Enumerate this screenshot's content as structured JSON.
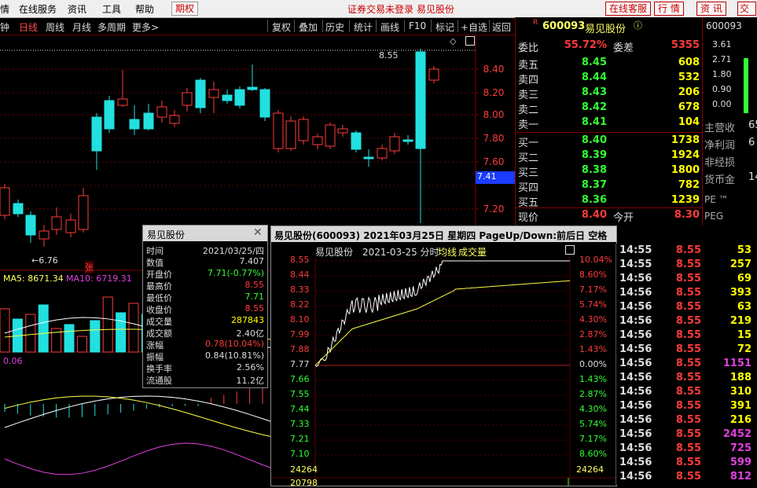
{
  "menubar": {
    "items": [
      "情",
      "在线服务",
      "资讯",
      "工具",
      "帮助"
    ],
    "active": "期权",
    "status": "证券交易未登录",
    "stock_name": "易见股份",
    "right_buttons": [
      "在线客服",
      "行 情",
      "资 讯",
      "交"
    ]
  },
  "toolbar": {
    "periods": [
      "钟",
      "日线",
      "周线",
      "月线",
      "多周期",
      "更多>"
    ],
    "tools": [
      "复权",
      "叠加",
      "历史",
      "统计",
      "画线",
      "F10",
      "标记",
      "+自选",
      "返回"
    ]
  },
  "kchart": {
    "price_labels": [
      "8.40",
      "8.20",
      "8.00",
      "7.80",
      "7.60",
      "7.20"
    ],
    "current_price": "7.41",
    "high_marker": "8.55",
    "low_marker": "6.76",
    "zhang": "张",
    "ma5": "MA5: 8671.34",
    "ma10": "MA10: 6719.31",
    "macd_val": "0.06"
  },
  "book": {
    "code": "600093",
    "name": "易见股份",
    "r_mark": "R",
    "wei_bi_label": "委比",
    "wei_bi": "55.72%",
    "wei_cha_label": "委差",
    "wei_cha": "5355",
    "sell": [
      {
        "label": "卖五",
        "price": "8.45",
        "vol": "608"
      },
      {
        "label": "卖四",
        "price": "8.44",
        "vol": "532"
      },
      {
        "label": "卖三",
        "price": "8.43",
        "vol": "206"
      },
      {
        "label": "卖二",
        "price": "8.42",
        "vol": "678"
      },
      {
        "label": "卖一",
        "price": "8.41",
        "vol": "104"
      }
    ],
    "buy": [
      {
        "label": "买一",
        "price": "8.40",
        "vol": "1738"
      },
      {
        "label": "买二",
        "price": "8.39",
        "vol": "1924"
      },
      {
        "label": "买三",
        "price": "8.38",
        "vol": "1800"
      },
      {
        "label": "买四",
        "price": "8.37",
        "vol": "782"
      },
      {
        "label": "买五",
        "price": "8.36",
        "vol": "1239"
      }
    ],
    "now_label": "现价",
    "now_price": "8.40",
    "open_label": "今开",
    "open_price": "8.30"
  },
  "mini": {
    "code": "600093",
    "values": [
      "3.61",
      "2.71",
      "1.80",
      "0.90",
      "0.00"
    ],
    "fund_labels": [
      "主营收",
      "净利润",
      "非经损",
      "货币金"
    ],
    "fund_vals": [
      "65",
      "6",
      "",
      "14"
    ],
    "pe": "PE ™",
    "peg": "PEG"
  },
  "info": {
    "title": "易见股份",
    "rows": [
      {
        "k": "时间",
        "v": "2021/03/25/四",
        "c": "#ddd"
      },
      {
        "k": "数值",
        "v": "7.407",
        "c": "#ddd"
      },
      {
        "k": "开盘价",
        "v": "7.71(-0.77%)",
        "c": "#3f3"
      },
      {
        "k": "最高价",
        "v": "8.55",
        "c": "#ff3b3b"
      },
      {
        "k": "最低价",
        "v": "7.71",
        "c": "#3f3"
      },
      {
        "k": "收盘价",
        "v": "8.55",
        "c": "#ff3b3b"
      },
      {
        "k": "成交量",
        "v": "287843",
        "c": "#ff0"
      },
      {
        "k": "成交额",
        "v": "2.40亿",
        "c": "#ddd"
      },
      {
        "k": "涨幅",
        "v": "0.78(10.04%)",
        "c": "#ff3b3b"
      },
      {
        "k": "振幅",
        "v": "0.84(10.81%)",
        "c": "#ddd"
      },
      {
        "k": "换手率",
        "v": "2.56%",
        "c": "#ddd"
      },
      {
        "k": "流通股",
        "v": "11.2亿",
        "c": "#ddd"
      }
    ]
  },
  "intra": {
    "title": "易见股份(600093) 2021年03月25日 星期四 PageUp/Down:前后日 空格键:操作",
    "sub_name": "易见股份",
    "sub_date": "2021-03-25 分时",
    "avg_label": "均线",
    "vol_label": "成交量",
    "left_prices": [
      "8.55",
      "8.44",
      "8.33",
      "8.22",
      "8.10",
      "7.99",
      "7.88",
      "7.77",
      "7.66",
      "7.55",
      "7.44",
      "7.33",
      "7.21",
      "7.10"
    ],
    "right_pcts": [
      "10.04%",
      "8.60%",
      "7.17%",
      "5.74%",
      "4.30%",
      "2.87%",
      "1.43%",
      "0.00%",
      "1.43%",
      "2.87%",
      "4.30%",
      "5.74%",
      "7.17%",
      "8.60%"
    ],
    "vol_top": "24264",
    "vol_bottom": "20798"
  },
  "ticks": [
    {
      "t": "14:55",
      "p": "8.55",
      "q": "53",
      "c": "#ff0"
    },
    {
      "t": "14:55",
      "p": "8.55",
      "q": "257",
      "c": "#ff0"
    },
    {
      "t": "14:56",
      "p": "8.55",
      "q": "69",
      "c": "#ff0"
    },
    {
      "t": "14:56",
      "p": "8.55",
      "q": "393",
      "c": "#ff0"
    },
    {
      "t": "14:56",
      "p": "8.55",
      "q": "63",
      "c": "#ff0"
    },
    {
      "t": "14:56",
      "p": "8.55",
      "q": "219",
      "c": "#ff0"
    },
    {
      "t": "14:56",
      "p": "8.55",
      "q": "15",
      "c": "#ff0"
    },
    {
      "t": "14:56",
      "p": "8.55",
      "q": "72",
      "c": "#ff0"
    },
    {
      "t": "14:56",
      "p": "8.55",
      "q": "1151",
      "c": "#e040e0"
    },
    {
      "t": "14:56",
      "p": "8.55",
      "q": "188",
      "c": "#ff0"
    },
    {
      "t": "14:56",
      "p": "8.55",
      "q": "310",
      "c": "#ff0"
    },
    {
      "t": "14:56",
      "p": "8.55",
      "q": "391",
      "c": "#ff0"
    },
    {
      "t": "14:56",
      "p": "8.55",
      "q": "216",
      "c": "#ff0"
    },
    {
      "t": "14:56",
      "p": "8.55",
      "q": "2452",
      "c": "#e040e0"
    },
    {
      "t": "14:56",
      "p": "8.55",
      "q": "725",
      "c": "#e040e0"
    },
    {
      "t": "14:56",
      "p": "8.55",
      "q": "599",
      "c": "#e040e0"
    },
    {
      "t": "14:56",
      "p": "8.55",
      "q": "812",
      "c": "#e040e0"
    }
  ],
  "colors": {
    "up": "#ff3b3b",
    "down": "#22e0e0",
    "bg": "#000000",
    "grid": "#7a0000"
  }
}
